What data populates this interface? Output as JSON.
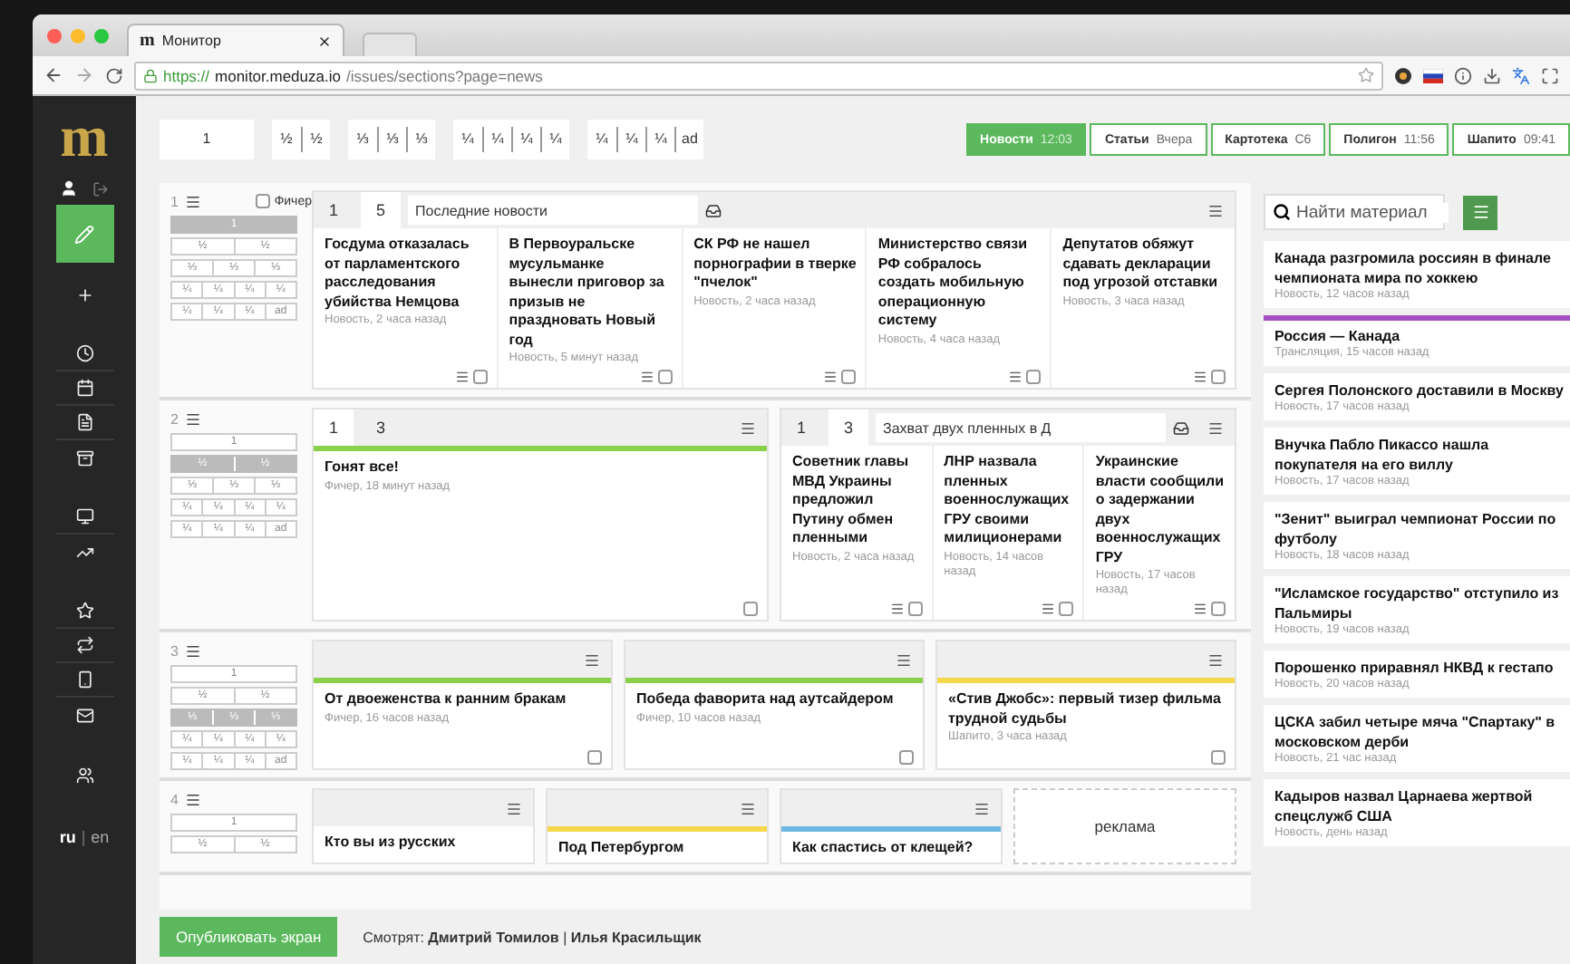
{
  "browser": {
    "favicon": "m",
    "tab_title": "Монитор",
    "url": {
      "scheme": "https://",
      "host": "monitor.meduza.io",
      "path": "/issues/sections?page=news"
    }
  },
  "sidebar": {
    "logo": "m",
    "language_separator": "|",
    "languages": [
      {
        "label": "ru",
        "selected": true
      },
      {
        "label": "en",
        "selected": false
      }
    ]
  },
  "toolbar": {
    "layouts": [
      [
        "1"
      ],
      [
        "½",
        "½"
      ],
      [
        "⅓",
        "⅓",
        "⅓"
      ],
      [
        "¼",
        "¼",
        "¼",
        "¼"
      ],
      [
        "¼",
        "¼",
        "¼",
        "ad"
      ]
    ],
    "screens": [
      {
        "name": "Новости",
        "time": "12:03",
        "selected": true
      },
      {
        "name": "Статьи",
        "time": "Вчера",
        "selected": false
      },
      {
        "name": "Картотека",
        "time": "C6",
        "selected": false
      },
      {
        "name": "Полигон",
        "time": "11:56",
        "selected": false
      },
      {
        "name": "Шапито",
        "time": "09:41",
        "selected": false
      }
    ]
  },
  "rows": [
    {
      "number": "1",
      "feature": {
        "label": "Фичер",
        "checked": false
      },
      "layouts": [
        {
          "cells": [
            "1"
          ],
          "selected": true
        },
        {
          "cells": [
            "½",
            "½"
          ],
          "selected": false
        },
        {
          "cells": [
            "⅓",
            "⅓",
            "⅓"
          ],
          "selected": false
        },
        {
          "cells": [
            "¼",
            "¼",
            "¼",
            "¼"
          ],
          "selected": false
        },
        {
          "cells": [
            "¼",
            "¼",
            "¼",
            "ad"
          ],
          "selected": false
        }
      ],
      "blocks": [
        {
          "kind": "news",
          "tabs": [
            {
              "label": "1",
              "selected": false
            },
            {
              "label": "5",
              "selected": true
            }
          ],
          "title": "Последние новости",
          "card_menu": true,
          "cards": [
            {
              "title": "Госдума отказалась от парламентского расследования убийства Немцова",
              "meta": "Новость, 2 часа назад",
              "checked": false
            },
            {
              "title": "В Первоуральске мусульманке вынесли приговор за призыв не праздновать Новый год",
              "meta": "Новость, 5 минут назад",
              "checked": false
            },
            {
              "title": "СК РФ не нашел порнографии в тверке \"пчелок\"",
              "meta": "Новость, 2 часа назад",
              "checked": false
            },
            {
              "title": "Министерство связи РФ собралось создать мобильную операционную систему",
              "meta": "Новость, 4 часа назад",
              "checked": false
            },
            {
              "title": "Депутатов обяжут сдавать декларации под угрозой отставки",
              "meta": "Новость, 3 часа назад",
              "checked": false
            }
          ]
        }
      ]
    },
    {
      "number": "2",
      "layouts": [
        {
          "cells": [
            "1"
          ],
          "selected": false
        },
        {
          "cells": [
            "½",
            "½"
          ],
          "selected": true
        },
        {
          "cells": [
            "⅓",
            "⅓",
            "⅓"
          ],
          "selected": false
        },
        {
          "cells": [
            "¼",
            "¼",
            "¼",
            "¼"
          ],
          "selected": false
        },
        {
          "cells": [
            "¼",
            "¼",
            "¼",
            "ad"
          ],
          "selected": false
        }
      ],
      "blocks": [
        {
          "kind": "news",
          "tabs": [
            {
              "label": "1",
              "selected": true
            },
            {
              "label": "3",
              "selected": false
            }
          ],
          "color": "#8bd04a",
          "card_menu": false,
          "cards": [
            {
              "title": "Гонят все!",
              "meta": "Фичер, 18 минут назад",
              "checked": false
            }
          ]
        },
        {
          "kind": "news",
          "tabs": [
            {
              "label": "1",
              "selected": false
            },
            {
              "label": "3",
              "selected": true
            }
          ],
          "title": "Захват двух пленных в Д",
          "card_menu": true,
          "cards": [
            {
              "title": "Советник главы МВД Украины предложил Путину обмен пленными",
              "meta": "Новость, 2 часа назад",
              "checked": false
            },
            {
              "title": "ЛНР назвала пленных военнослужащих ГРУ своими милиционерами",
              "meta": "Новость, 14 часов назад",
              "checked": false
            },
            {
              "title": "Украинские власти сообщили о задержании двух военнослужащих ГРУ",
              "meta": "Новость, 17 часов назад",
              "checked": false
            }
          ]
        }
      ]
    },
    {
      "number": "3",
      "layouts": [
        {
          "cells": [
            "1"
          ],
          "selected": false
        },
        {
          "cells": [
            "½",
            "½"
          ],
          "selected": false
        },
        {
          "cells": [
            "⅓",
            "⅓",
            "⅓"
          ],
          "selected": true
        },
        {
          "cells": [
            "¼",
            "¼",
            "¼",
            "¼"
          ],
          "selected": false
        },
        {
          "cells": [
            "¼",
            "¼",
            "¼",
            "ad"
          ],
          "selected": false
        }
      ],
      "blocks": [
        {
          "kind": "news",
          "color": "#8bd04a",
          "card_menu": false,
          "cards": [
            {
              "title": "От двоеженства к ранним бракам",
              "meta": "Фичер, 16 часов назад",
              "checked": false
            }
          ]
        },
        {
          "kind": "news",
          "color": "#8bd04a",
          "card_menu": false,
          "cards": [
            {
              "title": "Победа фаворита над аутсайдером",
              "meta": "Фичер, 10 часов назад",
              "checked": false
            }
          ]
        },
        {
          "kind": "news",
          "color": "#f5d84a",
          "card_menu": false,
          "cards": [
            {
              "title": "«Стив Джобс»: первый тизер фильма трудной судьбы",
              "meta": "Шапито, 3 часа назад",
              "checked": false
            }
          ]
        }
      ]
    },
    {
      "number": "4",
      "layouts": [
        {
          "cells": [
            "1"
          ],
          "selected": false
        },
        {
          "cells": [
            "½",
            "½"
          ],
          "selected": false
        }
      ],
      "blocks": [
        {
          "kind": "news",
          "cards": [
            {
              "title": "Кто вы из русских"
            }
          ]
        },
        {
          "kind": "news",
          "color": "#f5d84a",
          "cards": [
            {
              "title": "Под Петербургом"
            }
          ]
        },
        {
          "kind": "news",
          "color": "#6cb8e0",
          "cards": [
            {
              "title": "Как спастись от клещей?"
            }
          ]
        },
        {
          "kind": "ad",
          "label": "реклама"
        }
      ]
    }
  ],
  "publish_button": "Опубликовать экран",
  "viewers": "Смотрят: **Дмитрий Томилов** | **Илья Красильщик**",
  "search": {
    "placeholder": "Найти материал"
  },
  "feed": [
    {
      "title": "Канада разгромила россиян в финале чемпионата мира по хоккею",
      "meta": "Новость, 12 часов назад"
    },
    {
      "title": "Россия — Канада",
      "meta": "Трансляция, 15 часов назад",
      "color": "#a24fc2"
    },
    {
      "title": "Сергея Полонского доставили в Москву",
      "meta": "Новость, 17 часов назад"
    },
    {
      "title": "Внучка Пабло Пикассо нашла покупателя на его виллу",
      "meta": "Новость, 17 часов назад"
    },
    {
      "title": "\"Зенит\" выиграл чемпионат России по футболу",
      "meta": "Новость, 18 часов назад"
    },
    {
      "title": "\"Исламское государство\" отступило из Пальмиры",
      "meta": "Новость, 19 часов назад"
    },
    {
      "title": "Порошенко приравнял НКВД к гестапо",
      "meta": "Новость, 20 часов назад"
    },
    {
      "title": "ЦСКА забил четыре мяча \"Спартаку\" в московском дерби",
      "meta": "Новость, 21 час назад"
    },
    {
      "title": "Кадыров назвал Царнаева жертвой спецслужб США",
      "meta": "Новость, день назад"
    }
  ]
}
